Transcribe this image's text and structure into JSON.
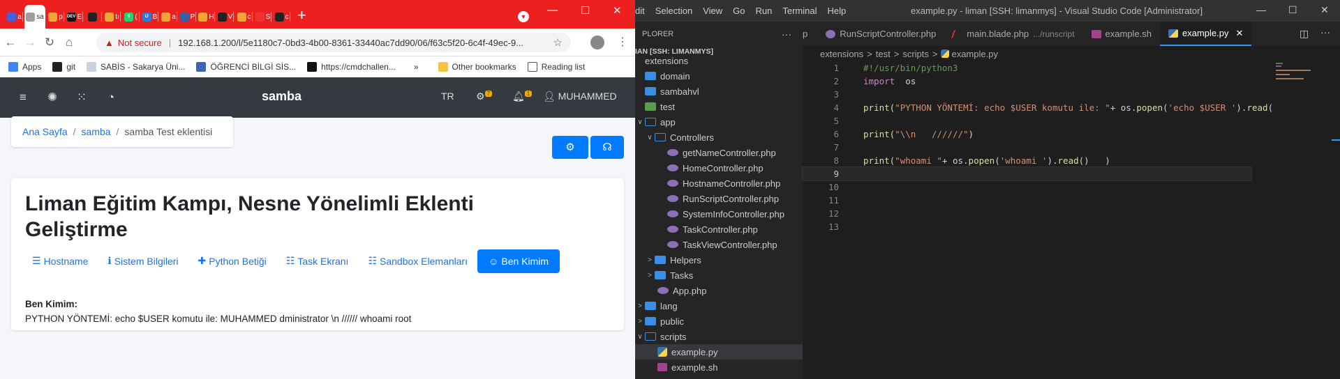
{
  "browser": {
    "tabs": [
      {
        "letter": "a",
        "color": "#4a60d9"
      },
      {
        "letter": "sa",
        "color": "#ffffff",
        "active": true
      },
      {
        "letter": "p",
        "color": "#f2a33a"
      },
      {
        "letter": "E",
        "color": "#111111",
        "icon_text": "DEV"
      },
      {
        "letter": "",
        "color": "#222222"
      },
      {
        "letter": "tı",
        "color": "#f2a33a"
      },
      {
        "letter": "(",
        "color": "#25d366",
        "icon_text": "9"
      },
      {
        "letter": "B",
        "color": "#2f7ad9",
        "icon_text": "iJ"
      },
      {
        "letter": "a",
        "color": "#f2a33a"
      },
      {
        "letter": "P",
        "color": "#3a5fa0"
      },
      {
        "letter": "H",
        "color": "#f2a33a"
      },
      {
        "letter": "V",
        "color": "#222222"
      },
      {
        "letter": "c",
        "color": "#f2a33a"
      },
      {
        "letter": "S",
        "color": "#e33"
      },
      {
        "letter": "c",
        "color": "#222222"
      }
    ],
    "new_tab": "+",
    "address": {
      "warning": "Not secure",
      "url": "192.168.1.200/l/5e1180c7-0bd3-4b00-8361-33440ac7dd90/06/f63c5f20-6c4f-49ec-9..."
    },
    "bookmarks": [
      {
        "label": "Apps",
        "color": "#4285f4"
      },
      {
        "label": "git",
        "color": "#222"
      },
      {
        "label": "SABİS - Sakarya Üni...",
        "color": "#c9d3e0"
      },
      {
        "label": "ÖĞRENCİ BİLGİ SİS...",
        "color": "#3b66b5"
      },
      {
        "label": "https://cmdchallen...",
        "color": "#111"
      }
    ],
    "more_bookmarks": "»",
    "other_bookmarks": "Other bookmarks",
    "reading_list": "Reading list"
  },
  "app": {
    "brand": "samba",
    "lang": "TR",
    "gear_badge": "7",
    "bell_badge": "1",
    "user": "MUHAMMED",
    "breadcrumb": {
      "home": "Ana Sayfa",
      "section": "samba",
      "current": "samba Test eklentisi"
    },
    "title": "Liman Eğitim Kampı, Nesne Yönelimli Eklenti Geliştirme",
    "tabs": [
      {
        "label": "Hostname",
        "icon": "server-icon"
      },
      {
        "label": "Sistem Bilgileri",
        "icon": "info-icon"
      },
      {
        "label": "Python Betiği",
        "icon": "puzzle-icon"
      },
      {
        "label": "Task Ekranı",
        "icon": "list-check-icon"
      },
      {
        "label": "Sandbox Elemanları",
        "icon": "list-icon"
      },
      {
        "label": "Ben Kimim",
        "icon": "smile-icon",
        "active": true
      }
    ],
    "result_title": "Ben Kimim:",
    "result_text": "PYTHON YÖNTEMİ: echo $USER komutu ile: MUHAMMED    dministrator \\n ////// whoami root"
  },
  "vscode": {
    "menu": [
      "dit",
      "Selection",
      "View",
      "Go",
      "Run",
      "Terminal",
      "Help"
    ],
    "title": "example.py - liman [SSH: limanmys] - Visual Studio Code [Administrator]",
    "explorer_label": "PLORER",
    "workspace": "IAN [SSH: LIMANMYS]",
    "tree": [
      {
        "label": "extensions",
        "type": "none",
        "indent": 1
      },
      {
        "label": "domain",
        "type": "folder",
        "indent": 1
      },
      {
        "label": "sambahvl",
        "type": "folder",
        "indent": 1
      },
      {
        "label": "test",
        "type": "test",
        "indent": 1
      },
      {
        "label": "app",
        "type": "open",
        "indent": 1,
        "chev": "∨"
      },
      {
        "label": "Controllers",
        "type": "open",
        "indent": 2,
        "chev": "∨"
      },
      {
        "label": "getNameController.php",
        "type": "php",
        "indent": 3
      },
      {
        "label": "HomeController.php",
        "type": "php",
        "indent": 3
      },
      {
        "label": "HostnameController.php",
        "type": "php",
        "indent": 3
      },
      {
        "label": "RunScriptController.php",
        "type": "php",
        "indent": 3
      },
      {
        "label": "SystemInfoController.php",
        "type": "php",
        "indent": 3
      },
      {
        "label": "TaskController.php",
        "type": "php",
        "indent": 3
      },
      {
        "label": "TaskViewController.php",
        "type": "php",
        "indent": 3
      },
      {
        "label": "Helpers",
        "type": "folder",
        "indent": 2,
        "chev": ">"
      },
      {
        "label": "Tasks",
        "type": "folder",
        "indent": 2,
        "chev": ">"
      },
      {
        "label": "App.php",
        "type": "php",
        "indent": 2
      },
      {
        "label": "lang",
        "type": "folder",
        "indent": 1,
        "chev": ">"
      },
      {
        "label": "public",
        "type": "folder",
        "indent": 1,
        "chev": ">"
      },
      {
        "label": "scripts",
        "type": "open",
        "indent": 1,
        "chev": "∨"
      },
      {
        "label": "example.py",
        "type": "py",
        "indent": 2,
        "selected": true
      },
      {
        "label": "example.sh",
        "type": "sh",
        "indent": 2
      }
    ],
    "editor_tabs": [
      {
        "label": "p",
        "icon": ""
      },
      {
        "label": "RunScriptController.php",
        "icon": "php"
      },
      {
        "label": "main.blade.php",
        "hint": ".../runscript",
        "icon": "blade"
      },
      {
        "label": "example.sh",
        "icon": "sh"
      },
      {
        "label": "example.py",
        "icon": "py",
        "active": true
      }
    ],
    "breadcrumb": [
      "extensions",
      "test",
      "scripts",
      "example.py"
    ],
    "lines": [
      {
        "no": "1",
        "parts": [
          [
            "cm",
            "#!/usr/bin/python3"
          ]
        ]
      },
      {
        "no": "2",
        "parts": [
          [
            "kw",
            "import"
          ],
          [
            "",
            "  os"
          ]
        ]
      },
      {
        "no": "3",
        "parts": []
      },
      {
        "no": "4",
        "parts": [
          [
            "fn",
            "print"
          ],
          [
            "",
            "("
          ],
          [
            "st",
            "\"PYTHON YÖNTEMİ: echo $USER komutu ile: \""
          ],
          [
            "",
            "+ os."
          ],
          [
            "fn",
            "popen"
          ],
          [
            "",
            "("
          ],
          [
            "st",
            "'echo $USER '"
          ],
          [
            "",
            ")."
          ],
          [
            "fn",
            "read"
          ],
          [
            "",
            "("
          ]
        ]
      },
      {
        "no": "5",
        "parts": []
      },
      {
        "no": "6",
        "parts": [
          [
            "fn",
            "print"
          ],
          [
            "",
            "("
          ],
          [
            "st",
            "\"\\\\n   //////\""
          ],
          [
            "",
            ")"
          ]
        ]
      },
      {
        "no": "7",
        "parts": []
      },
      {
        "no": "8",
        "parts": [
          [
            "fn",
            "print"
          ],
          [
            "",
            "("
          ],
          [
            "st",
            "\"whoami \""
          ],
          [
            "",
            "+ os."
          ],
          [
            "fn",
            "popen"
          ],
          [
            "",
            "("
          ],
          [
            "st",
            "'whoami '"
          ],
          [
            "",
            ")."
          ],
          [
            "fn",
            "read"
          ],
          [
            "",
            "()   )"
          ]
        ]
      },
      {
        "no": "9",
        "parts": [],
        "current": true
      },
      {
        "no": "10",
        "parts": []
      },
      {
        "no": "11",
        "parts": []
      },
      {
        "no": "12",
        "parts": []
      },
      {
        "no": "13",
        "parts": []
      }
    ]
  }
}
